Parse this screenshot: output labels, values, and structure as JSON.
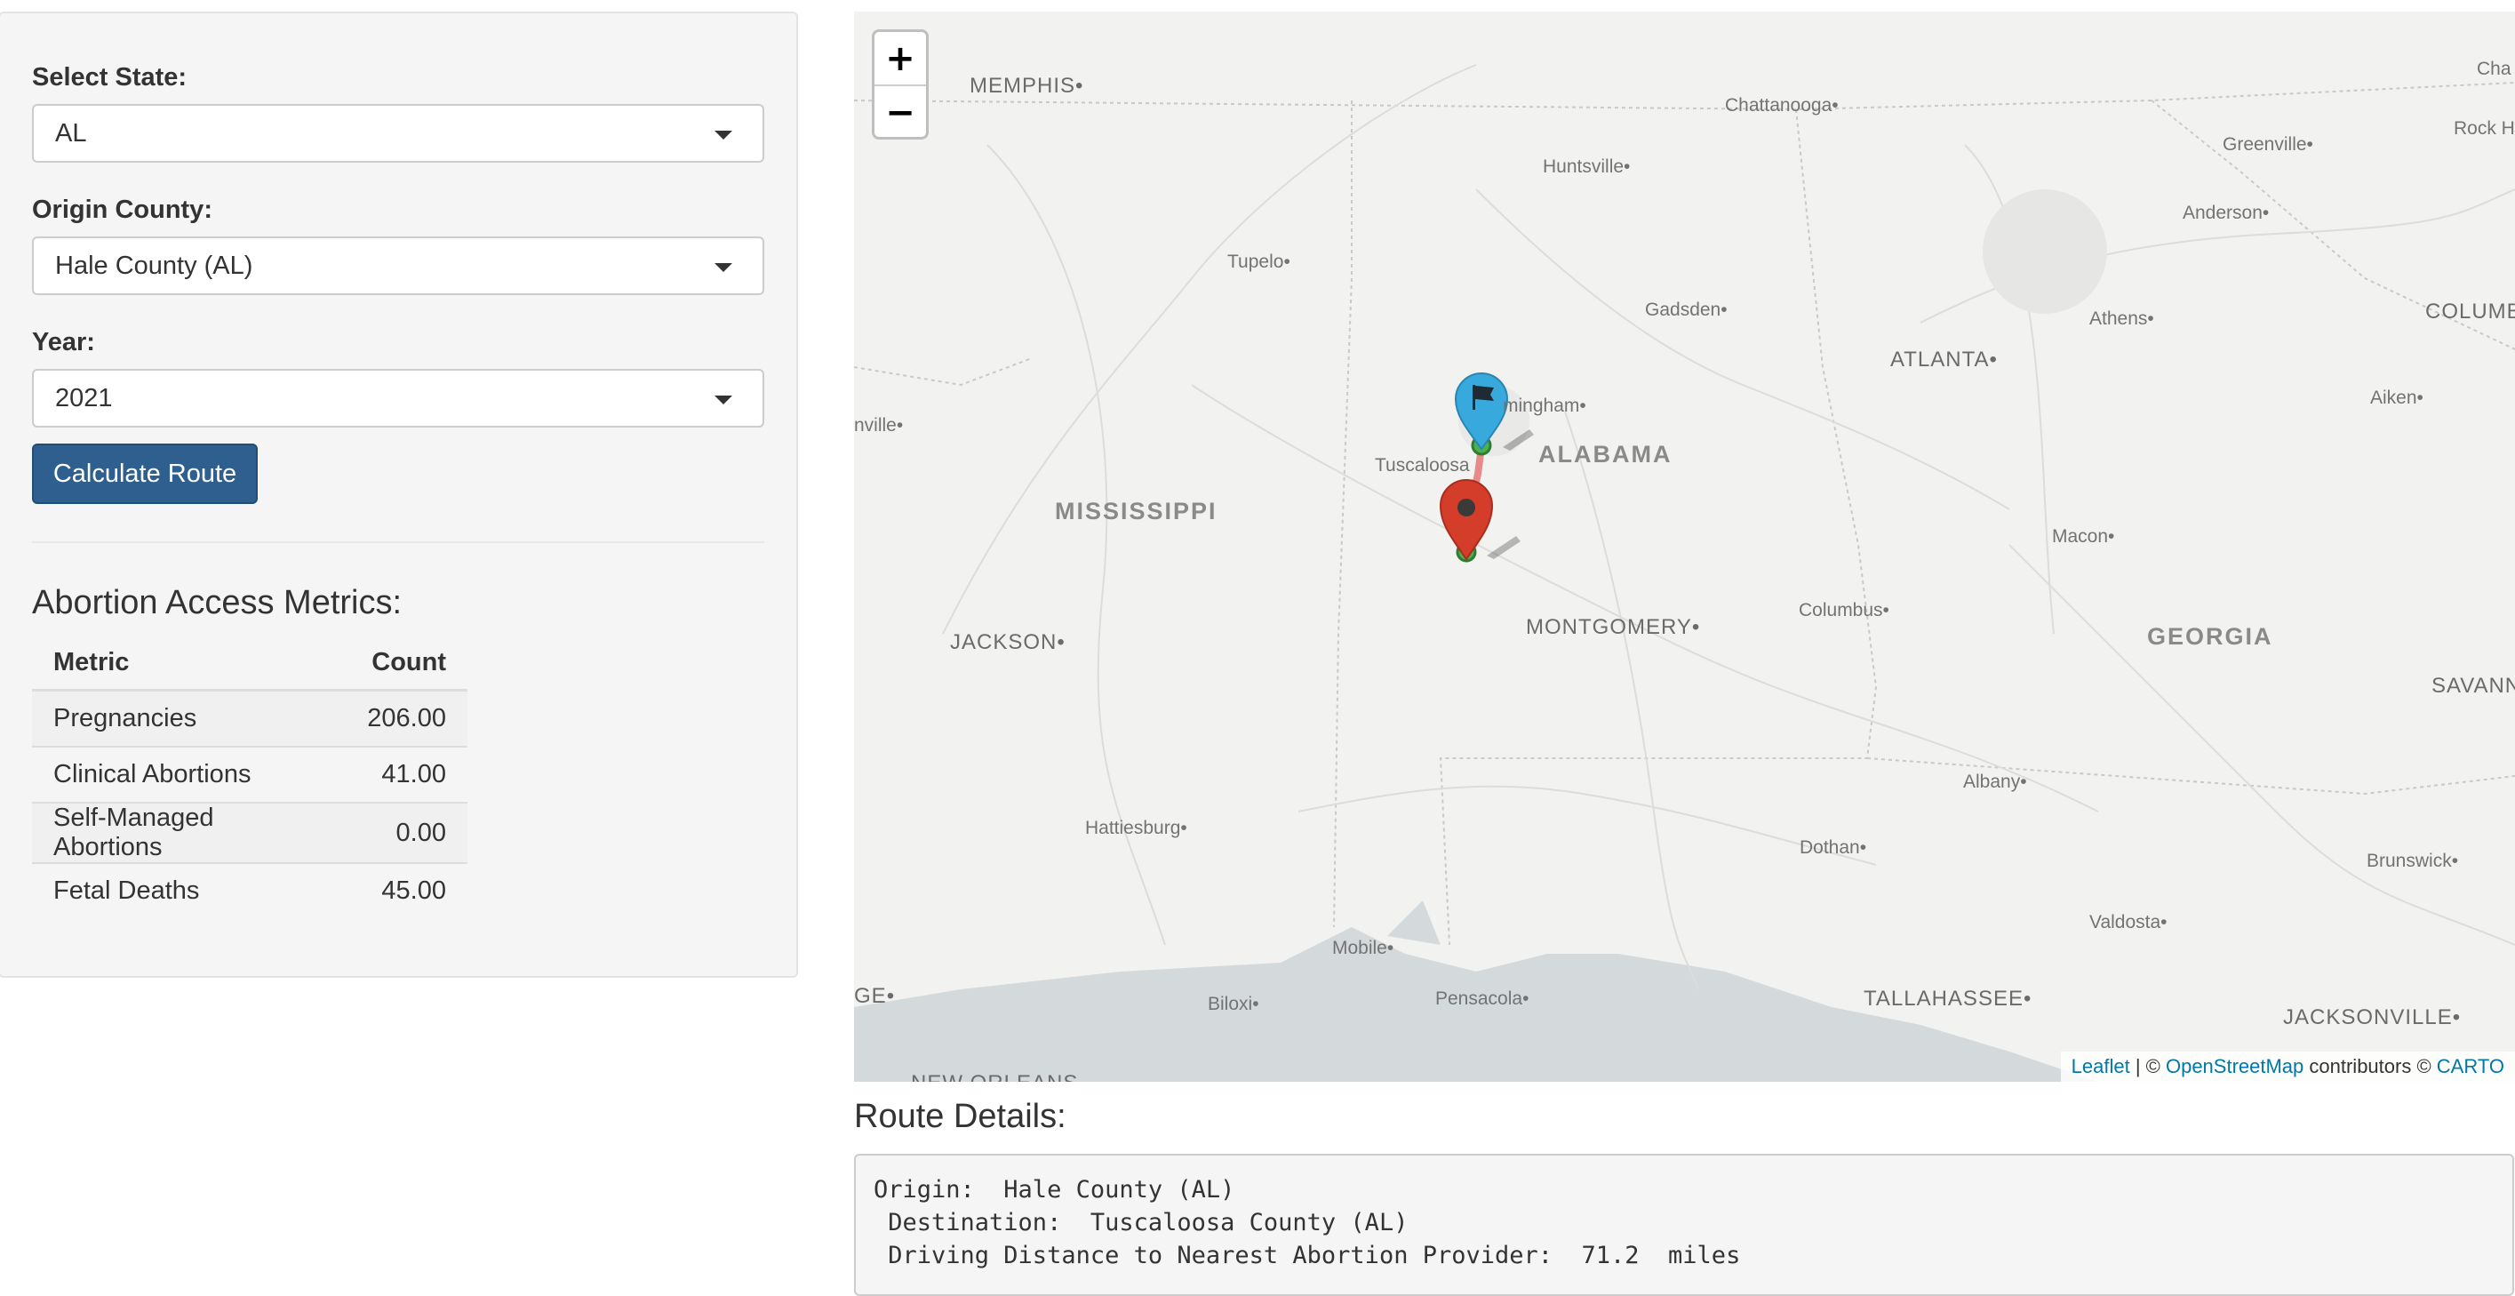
{
  "sidebar": {
    "state_label": "Select State:",
    "state_value": "AL",
    "county_label": "Origin County:",
    "county_value": "Hale County (AL)",
    "year_label": "Year:",
    "year_value": "2021",
    "calc_button": "Calculate Route",
    "metrics_title": "Abortion Access Metrics:",
    "metrics_headers": [
      "Metric",
      "Count"
    ],
    "metrics": [
      {
        "metric": "Pregnancies",
        "count": "206.00"
      },
      {
        "metric": "Clinical Abortions",
        "count": "41.00"
      },
      {
        "metric": "Self-Managed Abortions",
        "count": "0.00"
      },
      {
        "metric": "Fetal Deaths",
        "count": "45.00"
      }
    ]
  },
  "map": {
    "zoom_in": "+",
    "zoom_out": "−",
    "attribution": {
      "leaflet": "Leaflet",
      "sep": " | © ",
      "osm": "OpenStreetMap",
      "contrib": " contributors © ",
      "carto": "CARTO"
    },
    "labels": {
      "memphis": "MEMPHIS",
      "chattanooga": "Chattanooga",
      "huntsville": "Huntsville",
      "tupelo": "Tupelo",
      "gadsden": "Gadsden",
      "birmingham": "mingham",
      "tuscaloosa": "Tuscaloosa",
      "alabama": "ALABAMA",
      "mississippi": "MISSISSIPPI",
      "montgomery": "MONTGOMERY",
      "jackson": "JACKSON",
      "columbus": "Columbus",
      "georgia": "GEORGIA",
      "atlanta": "ATLANTA",
      "athens": "Athens",
      "macon": "Macon",
      "greenville": "Greenville",
      "anderson": "Anderson",
      "aiken": "Aiken",
      "columb": "COLUMB",
      "rockhill": "Rock H",
      "cha": "Cha",
      "savannah": "SAVANNAH",
      "albany": "Albany",
      "dothan": "Dothan",
      "hattiesburg": "Hattiesburg",
      "mobile": "Mobile",
      "pensacola": "Pensacola",
      "biloxi": "Biloxi",
      "tallahassee": "TALLAHASSEE",
      "valdosta": "Valdosta",
      "brunswick": "Brunswick",
      "jacksonville": "JACKSONVILLE",
      "ge": "GE",
      "nville": "nville",
      "neworleans": "NEW ORLEANS"
    }
  },
  "route": {
    "title": "Route Details:",
    "origin_line": "Origin:  Hale County (AL)",
    "destination_line": " Destination:  Tuscaloosa County (AL)",
    "distance_line": " Driving Distance to Nearest Abortion Provider:  71.2  miles"
  },
  "colors": {
    "button": "#2e5f8f",
    "marker_blue": "#38a9dc",
    "marker_red": "#d33d29",
    "route_line": "#e88a8a"
  }
}
